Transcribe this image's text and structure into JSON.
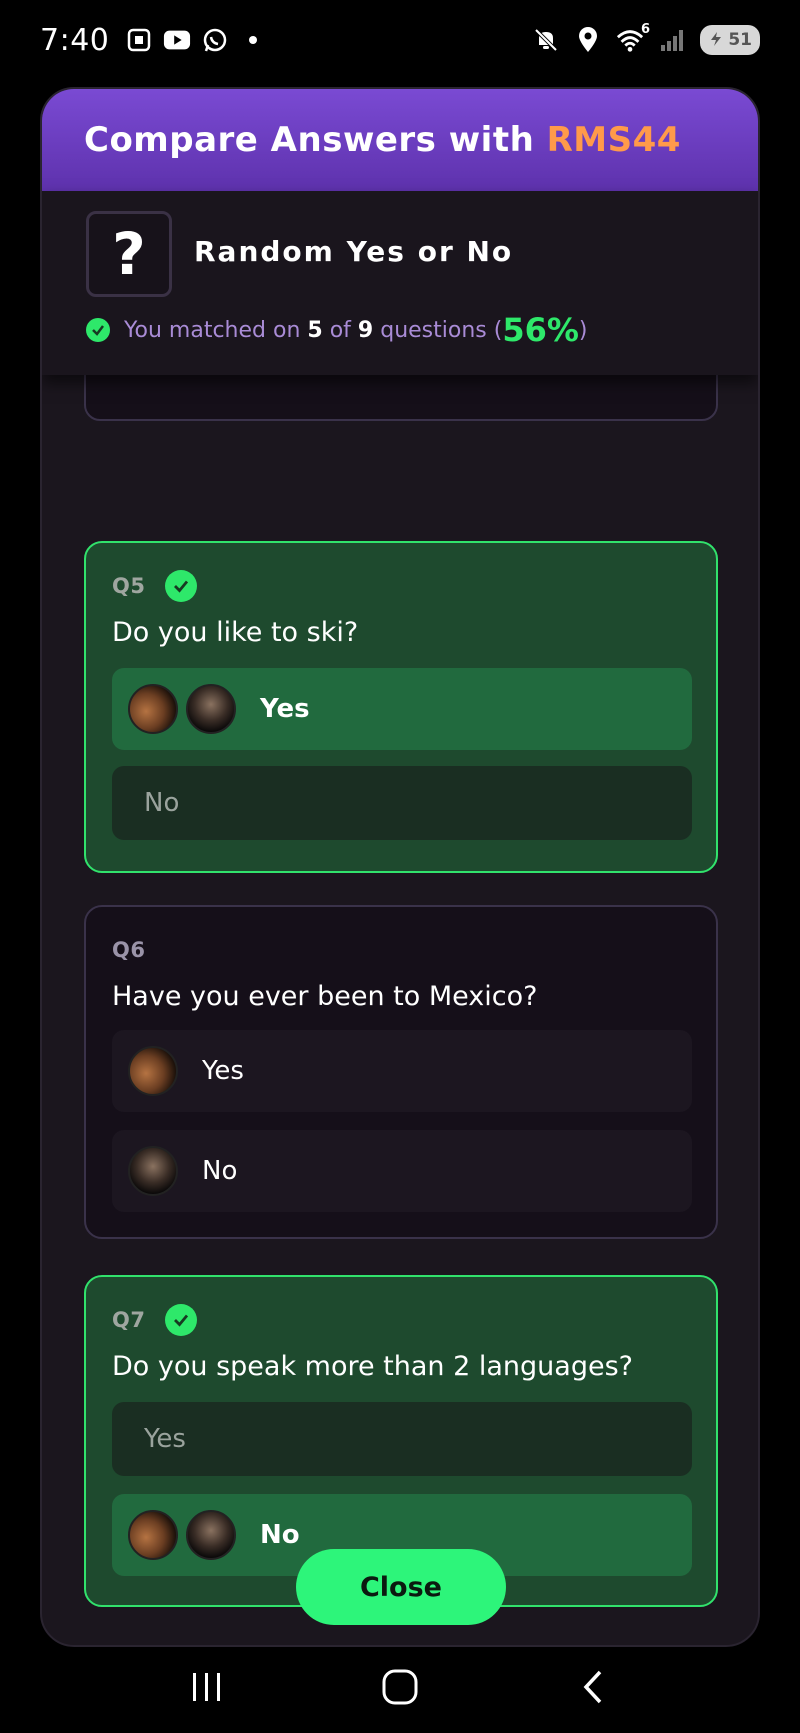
{
  "status_bar": {
    "time": "7:40",
    "left_icons": [
      "screenshot-icon",
      "youtube-icon",
      "whatsapp-icon",
      "dot-icon"
    ],
    "right_icons": [
      "mute-icon",
      "location-icon",
      "wifi-icon",
      "signal-icon"
    ],
    "wifi_badge": "6",
    "battery": "51"
  },
  "modal": {
    "title_prefix": "Compare Answers with ",
    "title_user": "RMS44",
    "quiz_icon": "?",
    "quiz_name": "Random Yes or No",
    "match": {
      "prefix": "You matched on",
      "matched": "5",
      "of_word": "of",
      "total": "9",
      "suffix": "questions (",
      "percent": "56%",
      "close_paren": ")"
    },
    "questions": [
      {
        "number": "Q5",
        "matched": true,
        "text": "Do you like to ski?",
        "options": [
          {
            "label": "Yes",
            "selected_by": [
              "player-1-avatar",
              "player-2-avatar"
            ]
          },
          {
            "label": "No",
            "selected_by": []
          }
        ]
      },
      {
        "number": "Q6",
        "matched": false,
        "text": "Have you ever been to Mexico?",
        "options": [
          {
            "label": "Yes",
            "selected_by": [
              "player-1-avatar"
            ]
          },
          {
            "label": "No",
            "selected_by": [
              "player-2-avatar"
            ]
          }
        ]
      },
      {
        "number": "Q7",
        "matched": true,
        "text": "Do you speak more than 2 languages?",
        "options": [
          {
            "label": "Yes",
            "selected_by": []
          },
          {
            "label": "No",
            "selected_by": [
              "player-1-avatar",
              "player-2-avatar"
            ]
          }
        ]
      }
    ],
    "close_label": "Close"
  },
  "colors": {
    "header_purple": "#6b3bc2",
    "accent_orange": "#ff9a4a",
    "match_green": "#2ee86a",
    "selected_green": "#216a3e"
  },
  "nav_bar": {
    "icons": [
      "recent-apps-icon",
      "home-icon",
      "back-icon"
    ]
  }
}
